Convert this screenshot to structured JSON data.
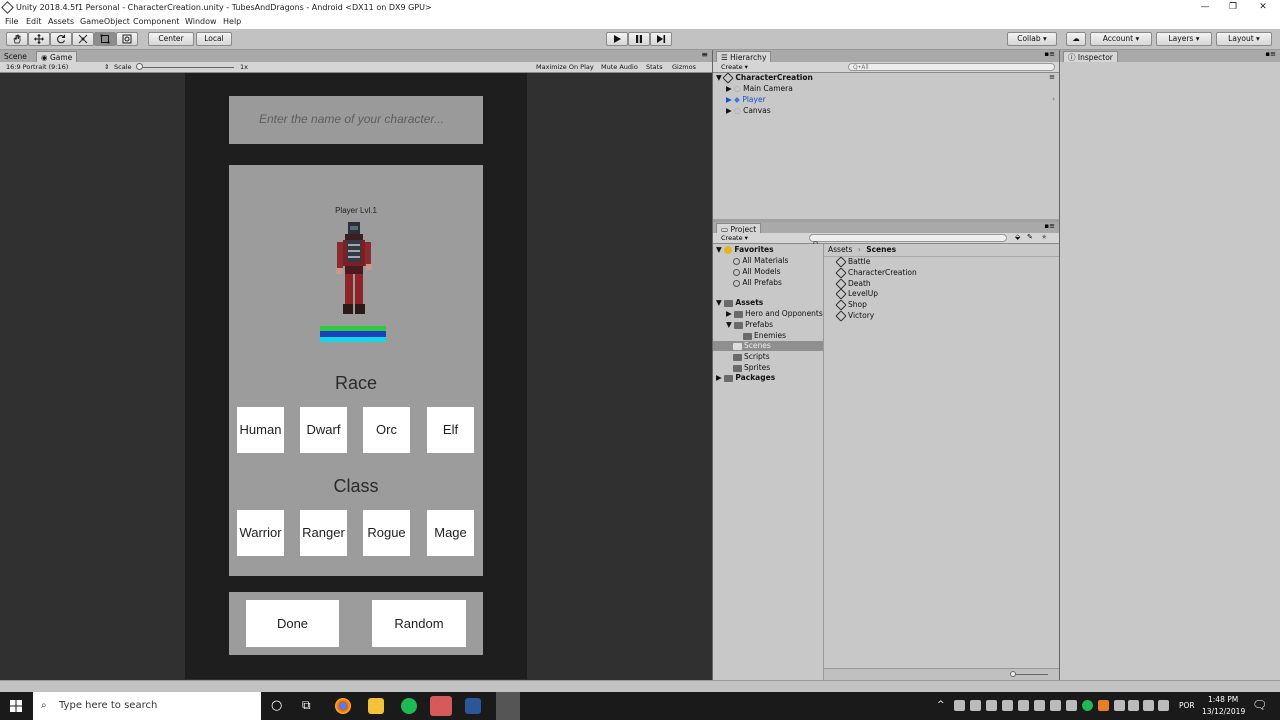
{
  "window": {
    "title": "Unity 2018.4.5f1 Personal - CharacterCreation.unity - TubesAndDragons - Android <DX11 on DX9 GPU>"
  },
  "menu": [
    "File",
    "Edit",
    "Assets",
    "GameObject",
    "Component",
    "Window",
    "Help"
  ],
  "toolbar": {
    "pivot": "Center",
    "space": "Local",
    "collab": "Collab",
    "account": "Account",
    "layers": "Layers",
    "layout": "Layout",
    "tool_icons": [
      "hand-icon",
      "move-icon",
      "rotate-icon",
      "scale-icon",
      "rect-icon",
      "transform-icon"
    ],
    "play_icons": [
      "play-icon",
      "pause-icon",
      "step-icon"
    ]
  },
  "game_view": {
    "tabs": [
      "Scene",
      "Game"
    ],
    "aspect": "16:9 Portrait (9:16)",
    "scale_label": "Scale",
    "scale_value": "1x",
    "options": [
      "Maximize On Play",
      "Mute Audio",
      "Stats",
      "Gizmos"
    ]
  },
  "game": {
    "name_placeholder": "Enter the name of your character...",
    "player_level": "Player Lvl.1",
    "bars": [
      {
        "color": "#2ecc40",
        "value": 1.0
      },
      {
        "color": "#1f3fbf",
        "value": 1.0
      },
      {
        "color": "#19d4e6",
        "value": 1.0
      }
    ],
    "race_label": "Race",
    "races": [
      "Human",
      "Dwarf",
      "Orc",
      "Elf"
    ],
    "class_label": "Class",
    "classes": [
      "Warrior",
      "Ranger",
      "Rogue",
      "Mage"
    ],
    "done": "Done",
    "random": "Random"
  },
  "hierarchy": {
    "tab": "Hierarchy",
    "create": "Create",
    "search_placeholder": "Q•All",
    "scene": "CharacterCreation",
    "items": [
      "Main Camera",
      "Player",
      "Canvas"
    ]
  },
  "project": {
    "tab": "Project",
    "create": "Create",
    "favorites": "Favorites",
    "favorite_items": [
      "All Materials",
      "All Models",
      "All Prefabs"
    ],
    "assets": "Assets",
    "asset_items": [
      "Hero and Opponents",
      "Prefabs",
      "Enemies",
      "Scenes",
      "Scripts",
      "Sprites"
    ],
    "packages": "Packages",
    "breadcrumb": [
      "Assets",
      "Scenes"
    ],
    "scenes": [
      "Battle",
      "CharacterCreation",
      "Death",
      "LevelUp",
      "Shop",
      "Victory"
    ]
  },
  "inspector": {
    "tab": "Inspector"
  },
  "taskbar": {
    "search_placeholder": "Type here to search",
    "language": "POR",
    "time": "1:48 PM",
    "date": "13/12/2019"
  }
}
